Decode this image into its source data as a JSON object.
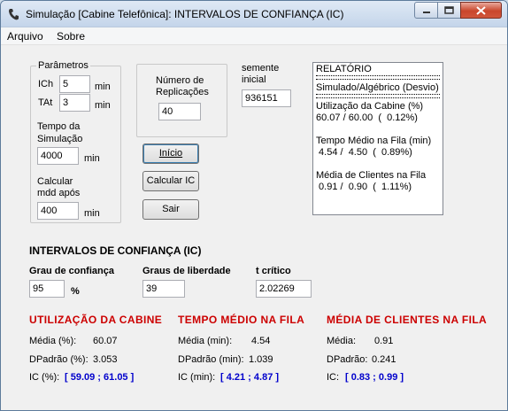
{
  "window": {
    "title": "Simulação [Cabine Telefônica]: INTERVALOS DE CONFIANÇA (IC)",
    "accent": "#c9462c"
  },
  "menu": [
    "Arquivo",
    "Sobre"
  ],
  "params": {
    "group_title": "Parâmetros",
    "ich_label": "ICh",
    "ich_value": "5",
    "ich_unit": "min",
    "tat_label": "TAt",
    "tat_value": "3",
    "tat_unit": "min",
    "tempo_label_1": "Tempo da",
    "tempo_label_2": "Simulação",
    "tempo_value": "4000",
    "tempo_unit": "min",
    "calc_label_1": "Calcular",
    "calc_label_2": "mdd após",
    "calc_value": "400",
    "calc_unit": "min"
  },
  "replicacoes": {
    "label_1": "Número de",
    "label_2": "Replicações",
    "value": "40"
  },
  "semente": {
    "label_1": "semente",
    "label_2": "inicial",
    "value": "936151"
  },
  "buttons": {
    "inicio": "Início",
    "calcular": "Calcular IC",
    "sair": "Sair"
  },
  "report": {
    "lines": [
      "RELATÓRIO",
      "Simulado/Algébrico (Desvio)",
      "Utilização da Cabine (%)",
      "60.07 / 60.00  (  0.12%)",
      "Tempo Médio na Fila (min)",
      " 4.54 /  4.50  (  0.89%)",
      "Média de Clientes na Fila",
      " 0.91 /  0.90  (  1.11%)"
    ]
  },
  "ic": {
    "heading": "INTERVALOS DE CONFIANÇA (IC)",
    "grau_label": "Grau de confiança",
    "grau_value": "95",
    "grau_unit": "%",
    "gl_label": "Graus de liberdade",
    "gl_value": "39",
    "t_label": "t crítico",
    "t_value": "2.02269"
  },
  "results": [
    {
      "heading": "UTILIZAÇÃO DA CABINE",
      "media_label": "Média (%):",
      "media": "60.07",
      "dp_label": "DPadrão (%):",
      "dp": "3.053",
      "ic_label": "IC (%):",
      "ic": "[ 59.09 ; 61.05 ]"
    },
    {
      "heading": "TEMPO MÉDIO NA FILA",
      "media_label": "Média (min):",
      "media": "4.54",
      "dp_label": "DPadrão (min):",
      "dp": "1.039",
      "ic_label": "IC (min):",
      "ic": "[ 4.21 ; 4.87 ]"
    },
    {
      "heading": "MÉDIA DE CLIENTES NA FILA",
      "media_label": "Média:",
      "media": "0.91",
      "dp_label": "DPadrão:",
      "dp": "0.241",
      "ic_label": "IC:",
      "ic": "[ 0.83 ; 0.99 ]"
    }
  ],
  "colors": {
    "heading_red": "#cc0000",
    "ic_blue": "#0000cc"
  }
}
